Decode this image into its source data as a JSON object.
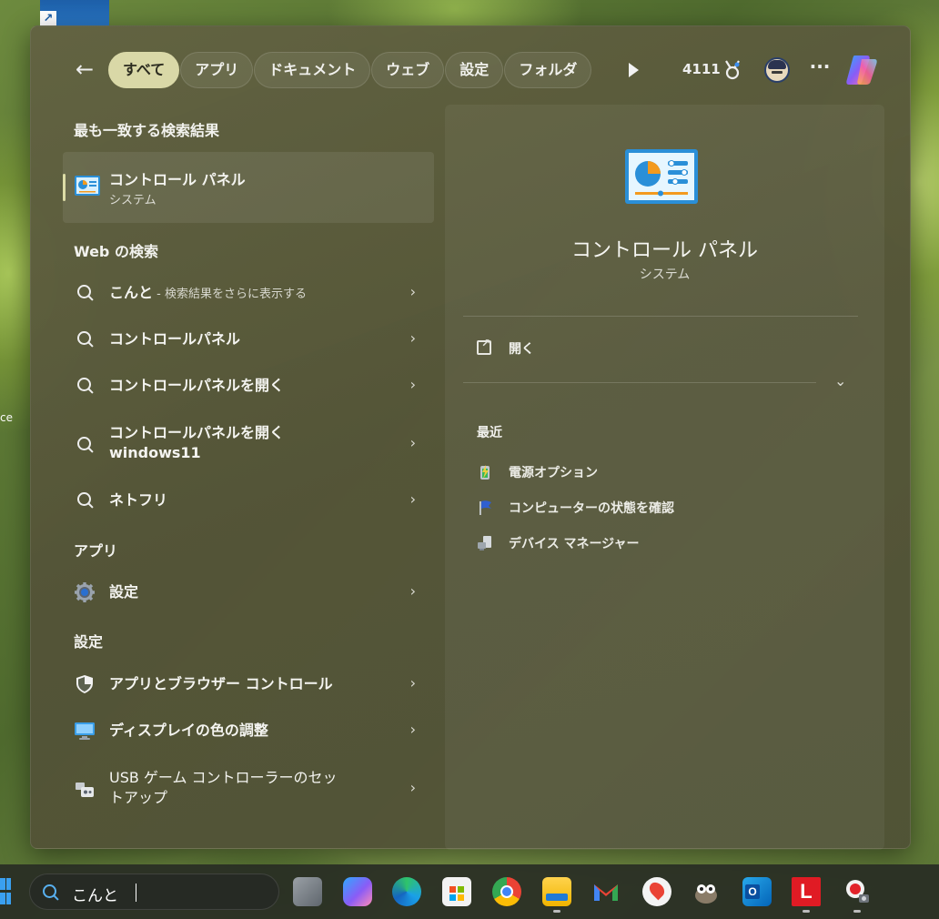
{
  "header": {
    "back_label": "←",
    "filters": [
      "すべて",
      "アプリ",
      "ドキュメント",
      "ウェブ",
      "設定",
      "フォルダ"
    ],
    "points": "4111",
    "more_label": "···"
  },
  "best_match": {
    "section_title": "最も一致する検索結果",
    "name": "コントロール パネル",
    "type": "システム"
  },
  "web": {
    "section_title": "Web の検索",
    "items": [
      {
        "text": "こんと",
        "hint": " - 検索結果をさらに表示する"
      },
      {
        "text": "コントロールパネル"
      },
      {
        "text": "コントロールパネルを開く"
      },
      {
        "text": "コントロールパネルを開く",
        "text2": "windows11"
      },
      {
        "text": "ネトフリ"
      }
    ]
  },
  "apps": {
    "section_title": "アプリ",
    "items": [
      {
        "text": "設定"
      }
    ]
  },
  "settings": {
    "section_title": "設定",
    "items": [
      {
        "text": "アプリとブラウザー コントロール"
      },
      {
        "text": "ディスプレイの色の調整"
      },
      {
        "text": "USB ゲーム コントローラーのセッ",
        "text2": "トアップ"
      }
    ]
  },
  "detail": {
    "title": "コントロール パネル",
    "subtitle": "システム",
    "open_label": "開く",
    "recent_title": "最近",
    "recent": [
      "電源オプション",
      "コンピューターの状態を確認",
      "デバイス マネージャー"
    ]
  },
  "taskbar": {
    "search_text": "こんと",
    "apps": [
      "task-view",
      "copilot",
      "edge",
      "microsoft-store",
      "chrome",
      "file-explorer",
      "gmail",
      "google-maps",
      "gimp",
      "outlook",
      "l-app",
      "snipping-tool"
    ]
  },
  "desktop": {
    "fragment_text": "ce"
  },
  "colors": {
    "active_filter": "#d9d8a7",
    "accent_bar": "#dcdca6",
    "search_accent": "#58b0f0"
  }
}
